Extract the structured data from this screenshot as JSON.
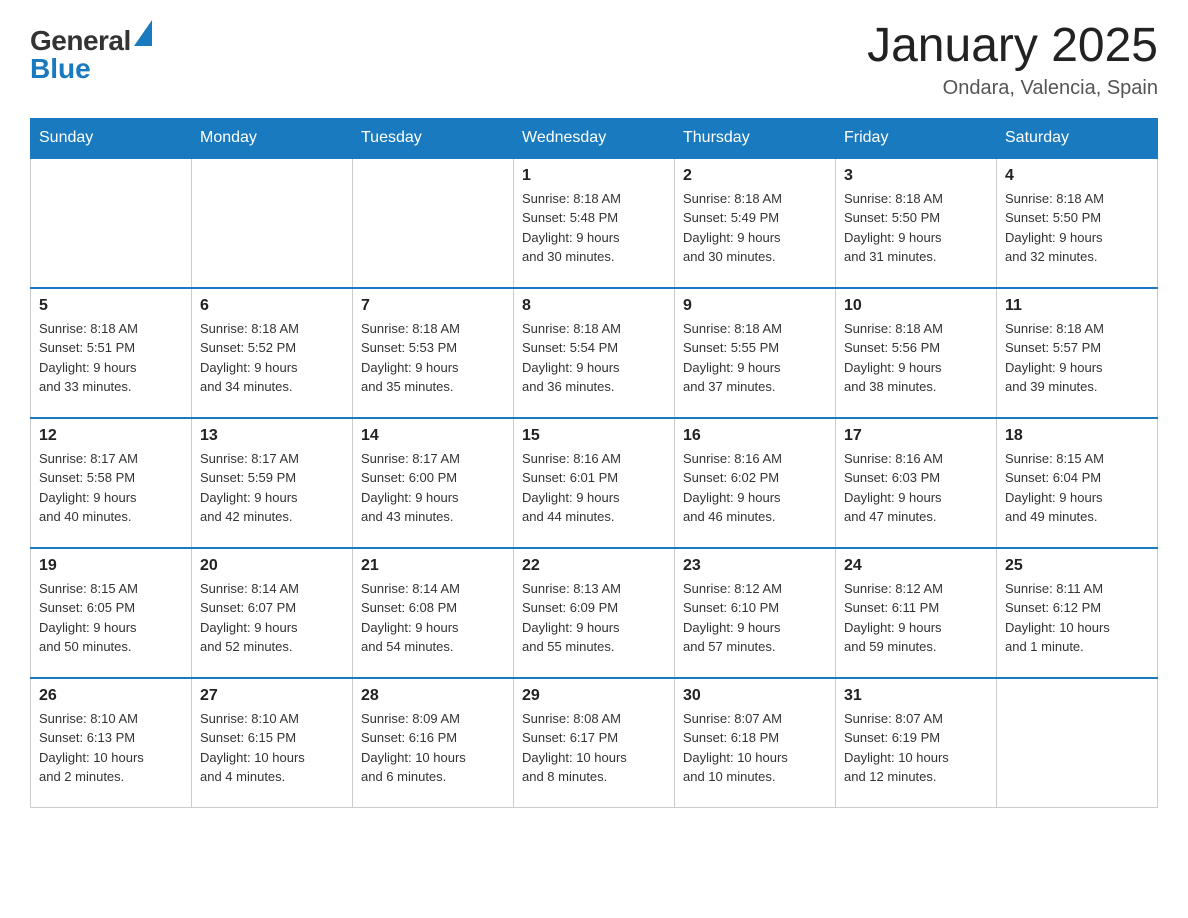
{
  "header": {
    "logo_general": "General",
    "logo_blue": "Blue",
    "title": "January 2025",
    "subtitle": "Ondara, Valencia, Spain"
  },
  "days_of_week": [
    "Sunday",
    "Monday",
    "Tuesday",
    "Wednesday",
    "Thursday",
    "Friday",
    "Saturday"
  ],
  "weeks": [
    {
      "days": [
        {
          "num": "",
          "info": ""
        },
        {
          "num": "",
          "info": ""
        },
        {
          "num": "",
          "info": ""
        },
        {
          "num": "1",
          "info": "Sunrise: 8:18 AM\nSunset: 5:48 PM\nDaylight: 9 hours\nand 30 minutes."
        },
        {
          "num": "2",
          "info": "Sunrise: 8:18 AM\nSunset: 5:49 PM\nDaylight: 9 hours\nand 30 minutes."
        },
        {
          "num": "3",
          "info": "Sunrise: 8:18 AM\nSunset: 5:50 PM\nDaylight: 9 hours\nand 31 minutes."
        },
        {
          "num": "4",
          "info": "Sunrise: 8:18 AM\nSunset: 5:50 PM\nDaylight: 9 hours\nand 32 minutes."
        }
      ]
    },
    {
      "days": [
        {
          "num": "5",
          "info": "Sunrise: 8:18 AM\nSunset: 5:51 PM\nDaylight: 9 hours\nand 33 minutes."
        },
        {
          "num": "6",
          "info": "Sunrise: 8:18 AM\nSunset: 5:52 PM\nDaylight: 9 hours\nand 34 minutes."
        },
        {
          "num": "7",
          "info": "Sunrise: 8:18 AM\nSunset: 5:53 PM\nDaylight: 9 hours\nand 35 minutes."
        },
        {
          "num": "8",
          "info": "Sunrise: 8:18 AM\nSunset: 5:54 PM\nDaylight: 9 hours\nand 36 minutes."
        },
        {
          "num": "9",
          "info": "Sunrise: 8:18 AM\nSunset: 5:55 PM\nDaylight: 9 hours\nand 37 minutes."
        },
        {
          "num": "10",
          "info": "Sunrise: 8:18 AM\nSunset: 5:56 PM\nDaylight: 9 hours\nand 38 minutes."
        },
        {
          "num": "11",
          "info": "Sunrise: 8:18 AM\nSunset: 5:57 PM\nDaylight: 9 hours\nand 39 minutes."
        }
      ]
    },
    {
      "days": [
        {
          "num": "12",
          "info": "Sunrise: 8:17 AM\nSunset: 5:58 PM\nDaylight: 9 hours\nand 40 minutes."
        },
        {
          "num": "13",
          "info": "Sunrise: 8:17 AM\nSunset: 5:59 PM\nDaylight: 9 hours\nand 42 minutes."
        },
        {
          "num": "14",
          "info": "Sunrise: 8:17 AM\nSunset: 6:00 PM\nDaylight: 9 hours\nand 43 minutes."
        },
        {
          "num": "15",
          "info": "Sunrise: 8:16 AM\nSunset: 6:01 PM\nDaylight: 9 hours\nand 44 minutes."
        },
        {
          "num": "16",
          "info": "Sunrise: 8:16 AM\nSunset: 6:02 PM\nDaylight: 9 hours\nand 46 minutes."
        },
        {
          "num": "17",
          "info": "Sunrise: 8:16 AM\nSunset: 6:03 PM\nDaylight: 9 hours\nand 47 minutes."
        },
        {
          "num": "18",
          "info": "Sunrise: 8:15 AM\nSunset: 6:04 PM\nDaylight: 9 hours\nand 49 minutes."
        }
      ]
    },
    {
      "days": [
        {
          "num": "19",
          "info": "Sunrise: 8:15 AM\nSunset: 6:05 PM\nDaylight: 9 hours\nand 50 minutes."
        },
        {
          "num": "20",
          "info": "Sunrise: 8:14 AM\nSunset: 6:07 PM\nDaylight: 9 hours\nand 52 minutes."
        },
        {
          "num": "21",
          "info": "Sunrise: 8:14 AM\nSunset: 6:08 PM\nDaylight: 9 hours\nand 54 minutes."
        },
        {
          "num": "22",
          "info": "Sunrise: 8:13 AM\nSunset: 6:09 PM\nDaylight: 9 hours\nand 55 minutes."
        },
        {
          "num": "23",
          "info": "Sunrise: 8:12 AM\nSunset: 6:10 PM\nDaylight: 9 hours\nand 57 minutes."
        },
        {
          "num": "24",
          "info": "Sunrise: 8:12 AM\nSunset: 6:11 PM\nDaylight: 9 hours\nand 59 minutes."
        },
        {
          "num": "25",
          "info": "Sunrise: 8:11 AM\nSunset: 6:12 PM\nDaylight: 10 hours\nand 1 minute."
        }
      ]
    },
    {
      "days": [
        {
          "num": "26",
          "info": "Sunrise: 8:10 AM\nSunset: 6:13 PM\nDaylight: 10 hours\nand 2 minutes."
        },
        {
          "num": "27",
          "info": "Sunrise: 8:10 AM\nSunset: 6:15 PM\nDaylight: 10 hours\nand 4 minutes."
        },
        {
          "num": "28",
          "info": "Sunrise: 8:09 AM\nSunset: 6:16 PM\nDaylight: 10 hours\nand 6 minutes."
        },
        {
          "num": "29",
          "info": "Sunrise: 8:08 AM\nSunset: 6:17 PM\nDaylight: 10 hours\nand 8 minutes."
        },
        {
          "num": "30",
          "info": "Sunrise: 8:07 AM\nSunset: 6:18 PM\nDaylight: 10 hours\nand 10 minutes."
        },
        {
          "num": "31",
          "info": "Sunrise: 8:07 AM\nSunset: 6:19 PM\nDaylight: 10 hours\nand 12 minutes."
        },
        {
          "num": "",
          "info": ""
        }
      ]
    }
  ]
}
